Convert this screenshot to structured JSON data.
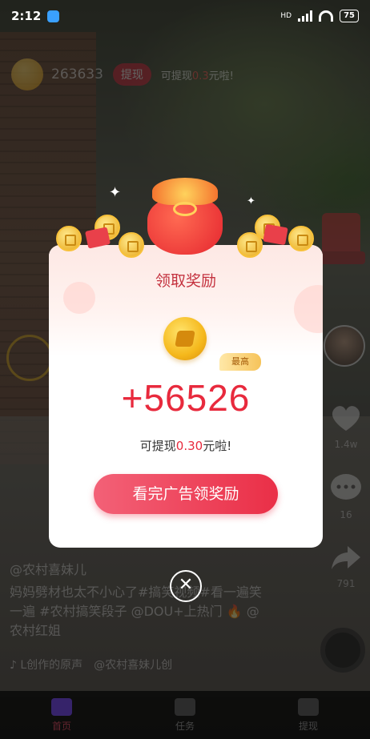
{
  "status_bar": {
    "time": "2:12",
    "network": "HD",
    "battery": "75"
  },
  "coin_bar": {
    "count": "263633",
    "withdraw_label": "提现",
    "tip_prefix": "可提现",
    "tip_amount": "0.3",
    "tip_suffix": "元啦!"
  },
  "side_actions": {
    "like_count": "1.4w",
    "comment_count": "16",
    "share_count": "791"
  },
  "caption": {
    "author": "@农村喜妹儿",
    "description": "妈妈劈材也太不小心了#搞笑视频#看一遍笑一遍 #农村搞笑段子 @DOU+上热门 🔥 @农村红姐",
    "music": "♪ L创作的原声　@农村喜妹儿创"
  },
  "nav": {
    "home": "首页",
    "tasks": "任务",
    "withdraw": "提现"
  },
  "modal": {
    "title": "领取奖励",
    "badge": "最高",
    "amount": "+56526",
    "tip_prefix": "可提现",
    "tip_amount": "0.30",
    "tip_suffix": "元啦!",
    "button": "看完广告领奖励",
    "close_symbol": "✕"
  },
  "colors": {
    "accent": "#e82a3d",
    "button_start": "#f36177",
    "button_end": "#ea2f47",
    "title": "#c4323f"
  }
}
